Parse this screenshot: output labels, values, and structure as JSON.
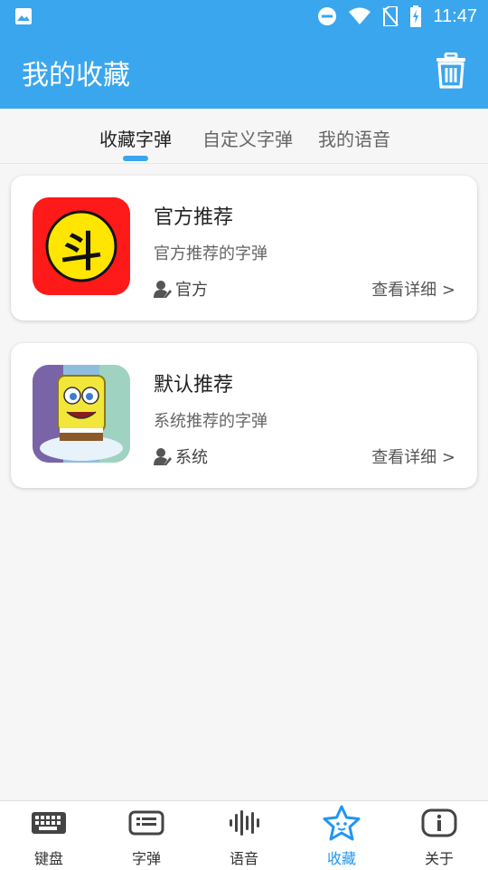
{
  "status_bar": {
    "time": "11:47"
  },
  "app_bar": {
    "title": "我的收藏",
    "trash_icon": "trash-icon"
  },
  "tabs": [
    {
      "label": "收藏字弹",
      "active": true
    },
    {
      "label": "自定义字弹",
      "active": false
    },
    {
      "label": "我的语音",
      "active": false
    }
  ],
  "cards": [
    {
      "title": "官方推荐",
      "subtitle": "官方推荐的字弹",
      "author": "官方",
      "more": "查看详细 >",
      "thumb_char": "斗",
      "thumb_bg": "#ff1a1a",
      "thumb_circle": "#ffe600"
    },
    {
      "title": "默认推荐",
      "subtitle": "系统推荐的字弹",
      "author": "系统",
      "more": "查看详细 >",
      "thumb_char": "",
      "thumb_bg": "#8fbde0",
      "thumb_circle": "#f3e63a"
    }
  ],
  "bottom_nav": [
    {
      "label": "键盘",
      "icon": "keyboard-icon",
      "active": false
    },
    {
      "label": "字弹",
      "icon": "subtitle-icon",
      "active": false
    },
    {
      "label": "语音",
      "icon": "voice-waveform-icon",
      "active": false
    },
    {
      "label": "收藏",
      "icon": "star-icon",
      "active": true
    },
    {
      "label": "关于",
      "icon": "info-icon",
      "active": false
    }
  ],
  "colors": {
    "primary": "#3aa6ee",
    "active_nav": "#2196f3"
  }
}
